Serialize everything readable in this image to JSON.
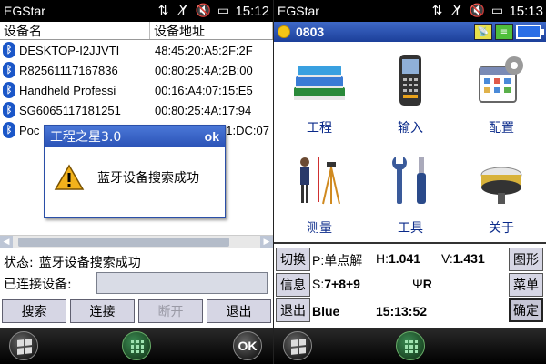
{
  "left": {
    "statusbar": {
      "title": "EGStar",
      "time": "15:12"
    },
    "table": {
      "headers": [
        "设备名",
        "设备地址"
      ],
      "rows": [
        {
          "name": "DESKTOP-I2JJVTI",
          "addr": "48:45:20:A5:2F:2F"
        },
        {
          "name": "R82561117167836",
          "addr": "00:80:25:4A:2B:00"
        },
        {
          "name": "Handheld Professi",
          "addr": "00:16:A4:07:15:E5"
        },
        {
          "name": "SG6065117181251",
          "addr": "00:80:25:4A:17:94"
        },
        {
          "name": "Poc",
          "addr": "1:DC:07"
        }
      ]
    },
    "status_label": "状态:",
    "status_value": "蓝牙设备搜索成功",
    "connected_label": "已连接设备:",
    "connected_value": "",
    "buttons": {
      "search": "搜索",
      "connect": "连接",
      "disconnect": "断开",
      "exit": "退出"
    },
    "dialog": {
      "title": "工程之星3.0",
      "ok": "ok",
      "message": "蓝牙设备搜索成功"
    },
    "taskbar": {
      "ok": "OK"
    }
  },
  "right": {
    "statusbar": {
      "title": "EGStar",
      "time": "15:13"
    },
    "header": {
      "id": "0803"
    },
    "menu": [
      {
        "label": "工程",
        "icon": "books-icon"
      },
      {
        "label": "输入",
        "icon": "handheld-device-icon"
      },
      {
        "label": "配置",
        "icon": "config-calendar-gear-icon"
      },
      {
        "label": "测量",
        "icon": "surveyor-tripod-icon"
      },
      {
        "label": "工具",
        "icon": "tools-wrench-screwdriver-icon"
      },
      {
        "label": "关于",
        "icon": "gnss-receiver-icon"
      }
    ],
    "info": {
      "switch": "切换",
      "info": "信息",
      "exit": "退出",
      "graph": "图形",
      "menu": "菜单",
      "confirm": "确定",
      "p_label": "P:",
      "p_value": "单点解",
      "h_label": "H:",
      "h_value": "1.041",
      "v_label": "V:",
      "v_value": "1.431",
      "s_label": "S:",
      "s_value": "7+8+9",
      "r_value": "R",
      "link": "Blue",
      "time": "15:13:52"
    }
  },
  "colors": {
    "accent_blue": "#2a52b6",
    "label_blue": "#0a2a8a",
    "button_bg": "#d6d6e4"
  }
}
